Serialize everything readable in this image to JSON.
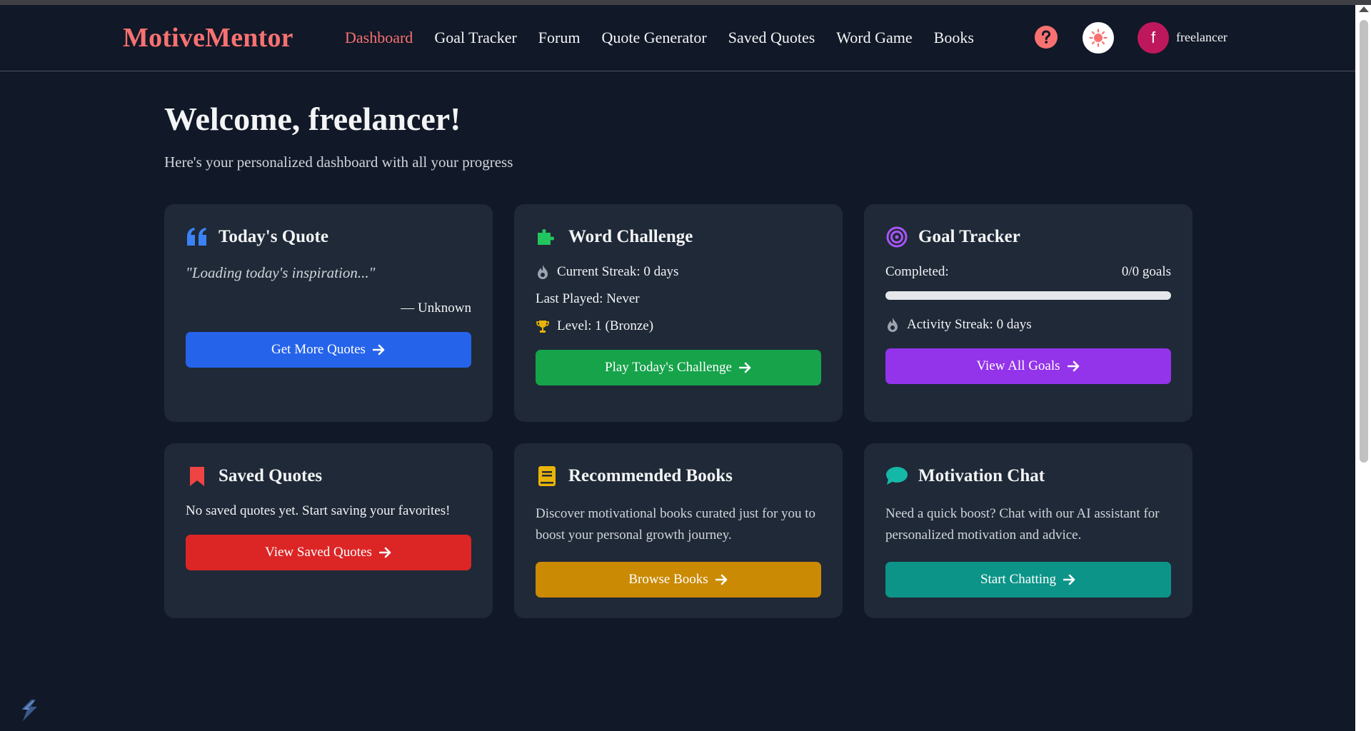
{
  "app": {
    "logo": "MotiveMentor",
    "username": "freelancer",
    "avatar_letter": "f"
  },
  "nav": {
    "items": [
      {
        "label": "Dashboard",
        "active": true
      },
      {
        "label": "Goal Tracker",
        "active": false
      },
      {
        "label": "Forum",
        "active": false
      },
      {
        "label": "Quote Generator",
        "active": false
      },
      {
        "label": "Saved Quotes",
        "active": false
      },
      {
        "label": "Word Game",
        "active": false
      },
      {
        "label": "Books",
        "active": false
      }
    ]
  },
  "main": {
    "title": "Welcome, freelancer!",
    "subtitle": "Here's your personalized dashboard with all your progress"
  },
  "cards": {
    "quote": {
      "title": "Today's Quote",
      "text": "\"Loading today's inspiration...\"",
      "author": "— Unknown",
      "button": "Get More Quotes",
      "color": "#2563eb",
      "icon": "quote-icon"
    },
    "word": {
      "title": "Word Challenge",
      "streak": "Current Streak: 0 days",
      "last_played": "Last Played: Never",
      "level": "Level: 1 (Bronze)",
      "button": "Play Today's Challenge",
      "color": "#16a34a",
      "icon": "puzzle-icon"
    },
    "goal": {
      "title": "Goal Tracker",
      "completed_label": "Completed:",
      "completed_value": "0/0 goals",
      "progress": 0,
      "activity": "Activity Streak: 0 days",
      "button": "View All Goals",
      "color": "#9333ea",
      "icon": "target-icon"
    },
    "saved": {
      "title": "Saved Quotes",
      "text": "No saved quotes yet. Start saving your favorites!",
      "button": "View Saved Quotes",
      "color": "#dc2626",
      "icon": "bookmark-icon"
    },
    "books": {
      "title": "Recommended Books",
      "text": "Discover motivational books curated just for you to boost your personal growth journey.",
      "button": "Browse Books",
      "color": "#ca8a04",
      "icon": "book-icon"
    },
    "chat": {
      "title": "Motivation Chat",
      "text": "Need a quick boost? Chat with our AI assistant for personalized motivation and advice.",
      "button": "Start Chatting",
      "color": "#0d9488",
      "icon": "chat-bubble-icon"
    }
  }
}
